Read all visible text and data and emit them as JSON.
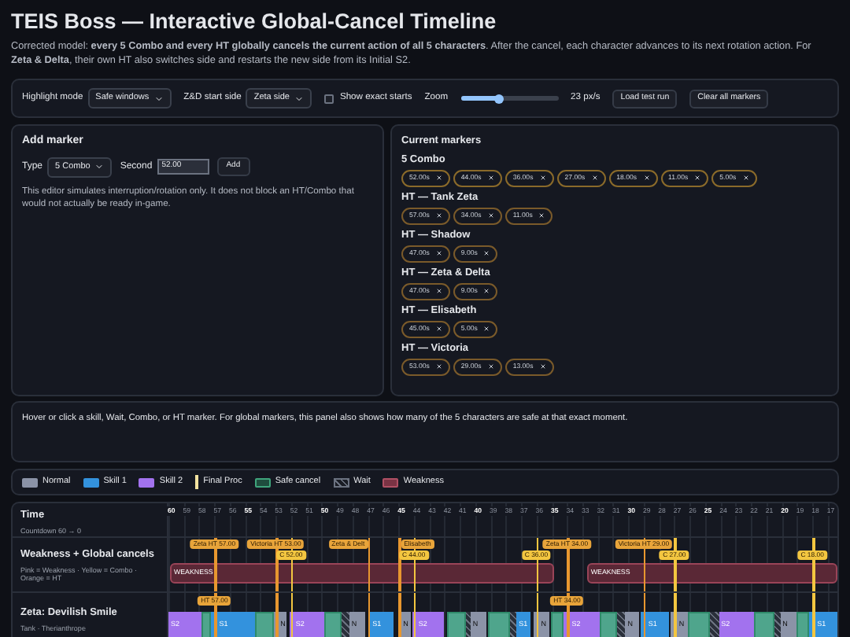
{
  "title": "TEIS Boss — Interactive Global-Cancel Timeline",
  "description": "Corrected model: **every 5 Combo and every HT globally cancels the current action of all 5 characters**. After the cancel, each character advances to its next rotation action. For **Zeta & Delta**, their own HT also switches side and restarts the new side from its Initial S2.",
  "controls": {
    "highlight_mode": {
      "label": "Highlight mode",
      "value": "Safe windows"
    },
    "start_side": {
      "label": "Z&D start side",
      "value": "Zeta side"
    },
    "show_exact_starts": {
      "label": "Show exact starts",
      "checked": false
    },
    "zoom": {
      "label": "Zoom",
      "level": 0.4,
      "reading": "23 px/s"
    },
    "buttons": [
      "Load test run",
      "Clear all markers"
    ]
  },
  "add_marker": {
    "title": "Add marker",
    "type_label": "Type",
    "type_value": "5 Combo",
    "second_label": "Second",
    "second_value": "52.00",
    "add_button": "Add",
    "note": "This editor simulates interruption/rotation only. It does not block an HT/Combo that would not actually be ready in-game."
  },
  "current_markers": {
    "title": "Current markers",
    "groups": [
      {
        "name": "5 Combo",
        "kind": "combo",
        "chips": [
          "52.00s",
          "44.00s",
          "36.00s",
          "27.00s",
          "18.00s",
          "11.00s",
          "5.00s"
        ]
      },
      {
        "name": "HT — Tank Zeta",
        "kind": "ht",
        "chips": [
          "57.00s",
          "34.00s",
          "11.00s"
        ]
      },
      {
        "name": "HT — Shadow",
        "kind": "ht",
        "chips": [
          "47.00s",
          "9.00s"
        ]
      },
      {
        "name": "HT — Zeta & Delta",
        "kind": "ht",
        "chips": [
          "47.00s",
          "9.00s"
        ]
      },
      {
        "name": "HT — Elisabeth",
        "kind": "ht",
        "chips": [
          "45.00s",
          "5.00s"
        ]
      },
      {
        "name": "HT — Victoria",
        "kind": "ht",
        "chips": [
          "53.00s",
          "29.00s",
          "13.00s"
        ]
      }
    ]
  },
  "info": "Hover or click a skill, Wait, Combo, or HT marker. For global markers, this panel also shows how many of the 5 characters are safe at that exact moment.",
  "legend": [
    {
      "kind": "normal",
      "label": "Normal"
    },
    {
      "kind": "skill1",
      "label": "Skill 1"
    },
    {
      "kind": "skill2",
      "label": "Skill 2"
    },
    {
      "kind": "final",
      "label": "Final Proc"
    },
    {
      "kind": "safe",
      "label": "Safe cancel"
    },
    {
      "kind": "wait",
      "label": "Wait"
    },
    {
      "kind": "weakness",
      "label": "Weakness"
    }
  ],
  "timeline": {
    "time_row": {
      "title": "Time",
      "subtitle": "Countdown 60 → 0",
      "ticks": [
        {
          "label": "60",
          "major": true
        },
        {
          "label": "59",
          "major": false
        },
        {
          "label": "58",
          "major": false
        },
        {
          "label": "57",
          "major": false
        },
        {
          "label": "56",
          "major": false
        },
        {
          "label": "55",
          "major": true
        },
        {
          "label": "54",
          "major": false
        },
        {
          "label": "53",
          "major": false
        },
        {
          "label": "52",
          "major": false
        },
        {
          "label": "51",
          "major": false
        },
        {
          "label": "50",
          "major": true
        },
        {
          "label": "49",
          "major": false
        },
        {
          "label": "48",
          "major": false
        },
        {
          "label": "47",
          "major": false
        },
        {
          "label": "46",
          "major": false
        },
        {
          "label": "45",
          "major": true
        },
        {
          "label": "44",
          "major": false
        },
        {
          "label": "43",
          "major": false
        },
        {
          "label": "42",
          "major": false
        },
        {
          "label": "41",
          "major": false
        },
        {
          "label": "40",
          "major": true
        },
        {
          "label": "39",
          "major": false
        },
        {
          "label": "38",
          "major": false
        },
        {
          "label": "37",
          "major": false
        },
        {
          "label": "36",
          "major": false
        },
        {
          "label": "35",
          "major": true
        },
        {
          "label": "34",
          "major": false
        },
        {
          "label": "33",
          "major": false
        },
        {
          "label": "32",
          "major": false
        },
        {
          "label": "31",
          "major": false
        },
        {
          "label": "30",
          "major": true
        },
        {
          "label": "29",
          "major": false
        },
        {
          "label": "28",
          "major": false
        },
        {
          "label": "27",
          "major": false
        },
        {
          "label": "26",
          "major": false
        },
        {
          "label": "25",
          "major": true
        },
        {
          "label": "24",
          "major": false
        },
        {
          "label": "23",
          "major": false
        },
        {
          "label": "22",
          "major": false
        },
        {
          "label": "21",
          "major": false
        },
        {
          "label": "20",
          "major": true
        },
        {
          "label": "19",
          "major": false
        },
        {
          "label": "18",
          "major": false
        },
        {
          "label": "17",
          "major": false
        }
      ]
    },
    "weakness_row": {
      "title": "Weakness + Global cancels",
      "subtitle": "Pink = Weakness · Yellow = Combo · Orange = HT",
      "bars": [
        {
          "label": "WEAKNESS"
        },
        {
          "label": "WEAKNESS"
        }
      ],
      "markers": [
        {
          "kind": "ht",
          "label": "Zeta HT 57.00"
        },
        {
          "kind": "ht",
          "label": "Victoria HT 53.00"
        },
        {
          "kind": "ht",
          "label": "Zeta & Delt"
        },
        {
          "kind": "ht",
          "label": "Elisabeth"
        },
        {
          "kind": "ht",
          "label": "Zeta HT 34.00"
        },
        {
          "kind": "ht",
          "label": "Victoria HT 29.00"
        },
        {
          "kind": "combo",
          "label": "C 52.00"
        },
        {
          "kind": "combo",
          "label": "C 44.00"
        },
        {
          "kind": "combo",
          "label": "C 36.00"
        },
        {
          "kind": "combo",
          "label": "C 27.00"
        },
        {
          "kind": "combo",
          "label": "C 18.00"
        }
      ]
    },
    "characters": [
      {
        "name": "Zeta: Devilish Smile",
        "subtitle": "Tank · Therianthrope",
        "ht_badges": [
          "HT 57.00",
          "HT 34.00"
        ],
        "segments": [
          {
            "kind": "skill2",
            "label": "S2"
          },
          {
            "kind": "safe"
          },
          {
            "kind": "skill1",
            "label": "S1"
          },
          {
            "kind": "safe"
          },
          {
            "kind": "normal",
            "label": "N"
          },
          {
            "kind": "skill2",
            "label": "S2"
          },
          {
            "kind": "safe"
          },
          {
            "kind": "wait"
          },
          {
            "kind": "normal",
            "label": "N"
          },
          {
            "kind": "skill1",
            "label": "S1"
          },
          {
            "kind": "normal",
            "label": "N"
          },
          {
            "kind": "skill2",
            "label": "S2"
          },
          {
            "kind": "safe"
          },
          {
            "kind": "wait"
          },
          {
            "kind": "normal",
            "label": "N"
          },
          {
            "kind": "safe"
          },
          {
            "kind": "wait"
          },
          {
            "kind": "skill1",
            "label": "S1"
          },
          {
            "kind": "normal",
            "label": "N"
          },
          {
            "kind": "safe"
          },
          {
            "kind": "skill2",
            "label": "S2"
          },
          {
            "kind": "safe"
          },
          {
            "kind": "wait"
          },
          {
            "kind": "normal",
            "label": "N"
          },
          {
            "kind": "skill1",
            "label": "S1"
          },
          {
            "kind": "normal",
            "label": "N"
          },
          {
            "kind": "safe"
          },
          {
            "kind": "wait"
          },
          {
            "kind": "skill2",
            "label": "S2"
          },
          {
            "kind": "safe"
          },
          {
            "kind": "wait"
          },
          {
            "kind": "normal",
            "label": "N"
          },
          {
            "kind": "safe"
          },
          {
            "kind": "skill1",
            "label": "S1"
          }
        ]
      }
    ]
  }
}
